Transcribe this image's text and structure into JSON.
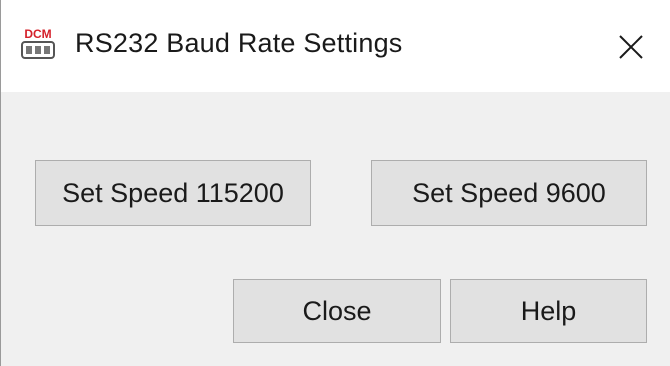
{
  "window": {
    "title": "RS232 Baud Rate Settings",
    "icon": "dcm-icon",
    "icon_text": "DCM",
    "close_glyph": "close-icon"
  },
  "buttons": {
    "speed_115200": "Set Speed 115200",
    "speed_9600": "Set Speed 9600",
    "close": "Close",
    "help": "Help"
  },
  "colors": {
    "titlebar_bg": "#ffffff",
    "client_bg": "#f0f0f0",
    "button_bg": "#e1e1e1",
    "button_border": "#adadad",
    "icon_red": "#d4202a"
  }
}
